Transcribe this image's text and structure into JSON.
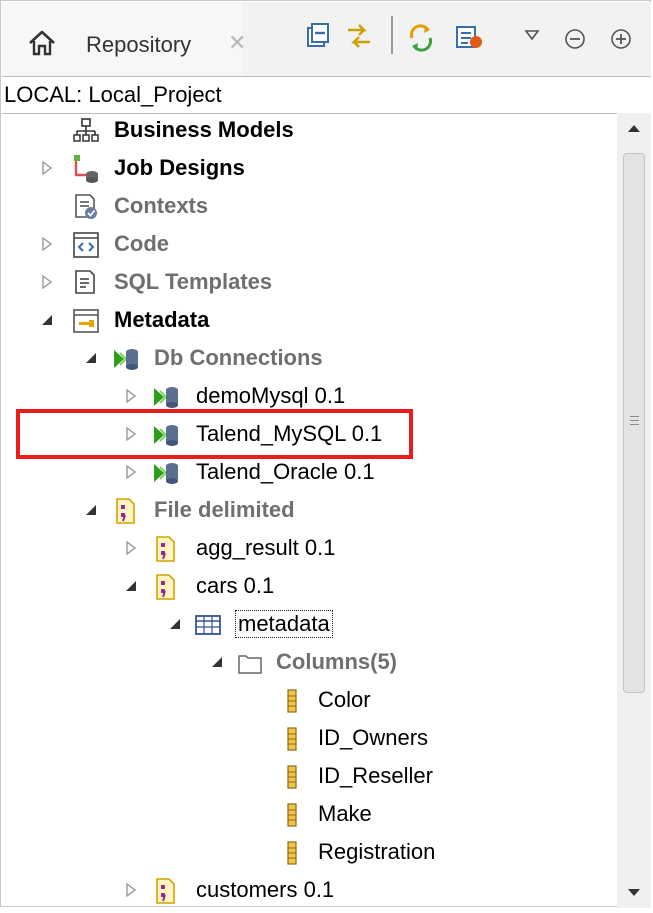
{
  "tab": {
    "label": "Repository",
    "close": "✕"
  },
  "toolbar": {
    "icons": [
      "collapse-all-icon",
      "link-with-editor-icon",
      "refresh-icon",
      "filter-icon",
      "view-menu-icon",
      "minimize-icon",
      "maximize-icon"
    ]
  },
  "project": {
    "label": "LOCAL: Local_Project"
  },
  "tree": {
    "business_models": "Business Models",
    "job_designs": "Job Designs",
    "contexts": "Contexts",
    "code": "Code",
    "sql_templates": "SQL Templates",
    "metadata": "Metadata",
    "db_connections": "Db Connections",
    "demomysql": "demoMysql 0.1",
    "talend_mysql": "Talend_MySQL 0.1",
    "talend_oracle": "Talend_Oracle 0.1",
    "file_delimited": "File delimited",
    "agg_result": "agg_result 0.1",
    "cars": "cars 0.1",
    "metadata_table": "metadata",
    "columns": "Columns(5)",
    "col_color": "Color",
    "col_id_owners": "ID_Owners",
    "col_id_reseller": "ID_Reseller",
    "col_make": "Make",
    "col_registration": "Registration",
    "customers": "customers 0.1"
  },
  "colors": {
    "highlight": "#ea1c1c",
    "db_green": "#2e9d1e",
    "file_yellow": "#e6b400"
  }
}
